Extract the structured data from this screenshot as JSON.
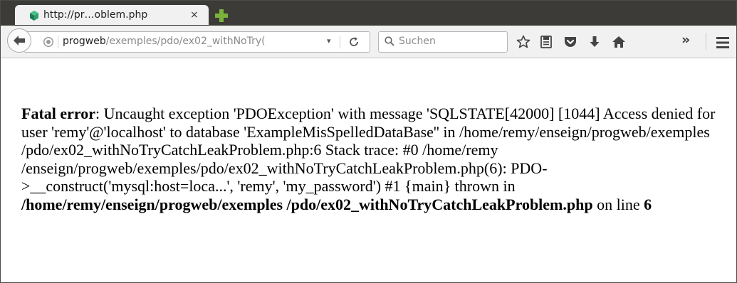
{
  "tab": {
    "title": "http://pr…oblem.php",
    "close": "×",
    "favicon_icon": "puzzle-piece-icon",
    "new_tab_icon": "plus-icon"
  },
  "nav": {
    "url_host": "progweb",
    "url_path": "/exemples/pdo/ex02_withNoTry(",
    "dropdown": "▾",
    "search_placeholder": "Suchen",
    "overflow": "»",
    "icons": [
      "back-arrow-icon",
      "info-icon",
      "reload-icon",
      "search-icon",
      "bookmark-star-icon",
      "reading-list-icon",
      "pocket-icon",
      "download-icon",
      "home-icon",
      "chevron-overflow-icon",
      "hamburger-menu-icon"
    ]
  },
  "error": {
    "label": "Fatal error",
    "message": ": Uncaught exception 'PDOException' with message 'SQLSTATE[42000] [1044] Access denied for user 'remy'@'localhost' to database 'ExampleMisSpelledDataBase'' in /home/remy/enseign/progweb/exemples /pdo/ex02_withNoTryCatchLeakProblem.php:6 Stack trace: #0 /home/remy /enseign/progweb/exemples/pdo/ex02_withNoTryCatchLeakProblem.php(6): PDO->__construct('mysql:host=loca...', 'remy', 'my_password') #1 {main} thrown in ",
    "file": "/home/remy/enseign/progweb/exemples /pdo/ex02_withNoTryCatchLeakProblem.php",
    "line_label": " on line ",
    "line": "6"
  },
  "colors": {
    "tab_strip": "#3c3b37",
    "toolbar": "#f1f1f1",
    "favicon_green": "#2f9e6a",
    "new_tab_green": "#7ab33b"
  }
}
